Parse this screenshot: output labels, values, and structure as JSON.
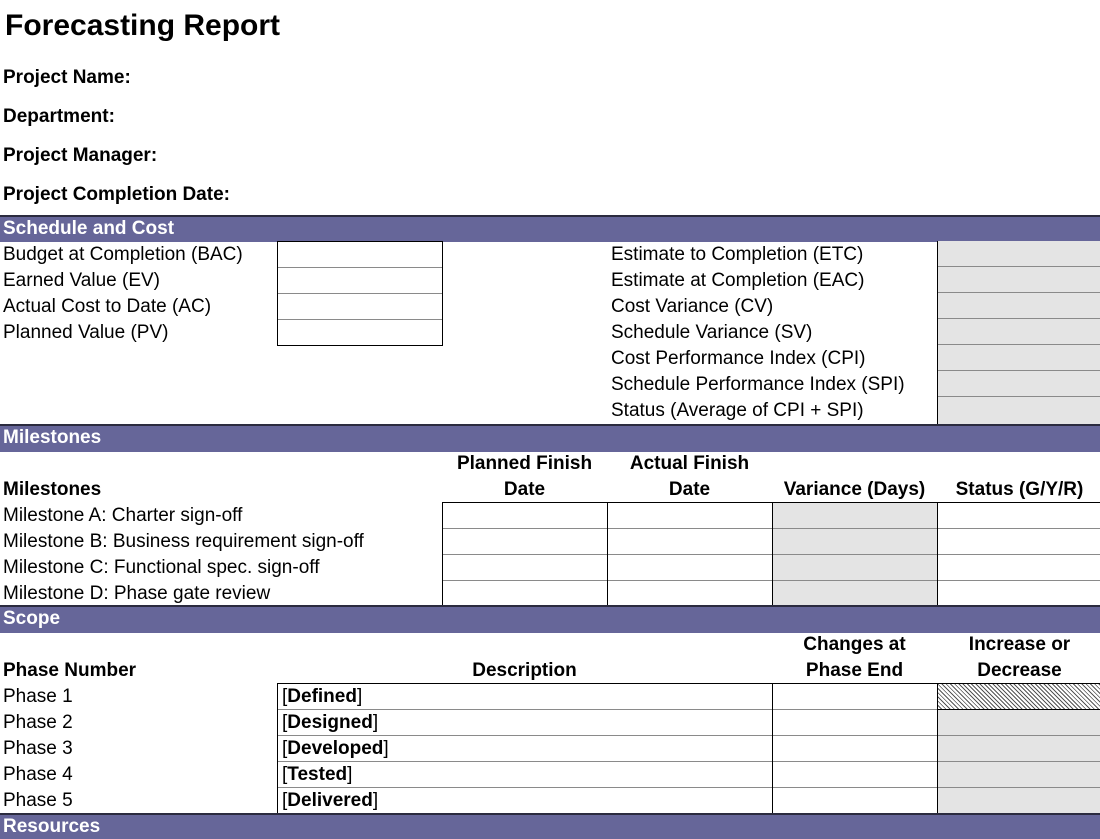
{
  "title": "Forecasting Report",
  "project_info": [
    {
      "label": "Project Name:",
      "value": ""
    },
    {
      "label": "Department:",
      "value": ""
    },
    {
      "label": "Project Manager:",
      "value": ""
    },
    {
      "label": "Project Completion Date:",
      "value": ""
    }
  ],
  "schedule_cost": {
    "header": "Schedule and Cost",
    "inputs": [
      {
        "label": "Budget at Completion (BAC)",
        "value": ""
      },
      {
        "label": "Earned Value (EV)",
        "value": ""
      },
      {
        "label": "Actual Cost to Date (AC)",
        "value": ""
      },
      {
        "label": "Planned Value (PV)",
        "value": ""
      }
    ],
    "calculated": [
      {
        "label": "Estimate to Completion (ETC)",
        "value": ""
      },
      {
        "label": "Estimate at Completion (EAC)",
        "value": ""
      },
      {
        "label": "Cost Variance (CV)",
        "value": ""
      },
      {
        "label": "Schedule Variance (SV)",
        "value": ""
      },
      {
        "label": "Cost Performance Index (CPI)",
        "value": ""
      },
      {
        "label": "Schedule Performance Index (SPI)",
        "value": ""
      },
      {
        "label": "Status (Average of CPI + SPI)",
        "value": ""
      }
    ]
  },
  "milestones": {
    "header": "Milestones",
    "columns": {
      "name": "Milestones",
      "planned_line1": "Planned Finish",
      "planned_line2": "Date",
      "actual_line1": "Actual Finish",
      "actual_line2": "Date",
      "variance": "Variance (Days)",
      "status": "Status (G/Y/R)"
    },
    "rows": [
      {
        "name": "Milestone A: Charter sign-off",
        "planned": "",
        "actual": "",
        "variance": "",
        "status": ""
      },
      {
        "name": "Milestone B: Business requirement sign-off",
        "planned": "",
        "actual": "",
        "variance": "",
        "status": ""
      },
      {
        "name": "Milestone C: Functional spec. sign-off",
        "planned": "",
        "actual": "",
        "variance": "",
        "status": ""
      },
      {
        "name": "Milestone D: Phase gate review",
        "planned": "",
        "actual": "",
        "variance": "",
        "status": ""
      }
    ]
  },
  "scope": {
    "header": "Scope",
    "columns": {
      "phase": "Phase Number",
      "description": "Description",
      "changes_line1": "Changes at",
      "changes_line2": "Phase End",
      "incdec_line1": "Increase or",
      "incdec_line2": "Decrease"
    },
    "rows": [
      {
        "phase": "Phase 1",
        "open": "[",
        "description": "Defined",
        "close": "]",
        "changes": "",
        "incdec": ""
      },
      {
        "phase": "Phase 2",
        "open": "[",
        "description": "Designed",
        "close": "]",
        "changes": "",
        "incdec": ""
      },
      {
        "phase": "Phase 3",
        "open": "[",
        "description": "Developed",
        "close": "]",
        "changes": "",
        "incdec": ""
      },
      {
        "phase": "Phase 4",
        "open": "[",
        "description": "Tested",
        "close": "]",
        "changes": "",
        "incdec": ""
      },
      {
        "phase": "Phase 5",
        "open": "[",
        "description": "Delivered",
        "close": "]",
        "changes": "",
        "incdec": ""
      }
    ]
  },
  "resources": {
    "header": "Resources"
  },
  "colors": {
    "section_header": "#666699",
    "calculated_cell": "#e4e4e4"
  }
}
